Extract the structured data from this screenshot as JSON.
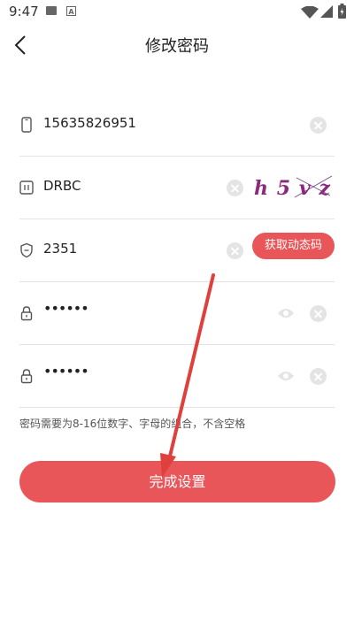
{
  "status_bar": {
    "time": "9:47",
    "icons": [
      "photo-icon",
      "a-notification-icon",
      "wifi-icon",
      "signal-icon",
      "battery-charging-icon"
    ]
  },
  "header": {
    "title": "修改密码",
    "back_icon": "chevron-left-icon"
  },
  "form": {
    "phone": {
      "value": "15635826951",
      "icon": "phone-icon"
    },
    "captcha": {
      "value": "DRBC",
      "icon": "captcha-icon",
      "image_text": "h5vz"
    },
    "sms_code": {
      "value": "2351",
      "icon": "shield-icon",
      "button_label": "获取动态码"
    },
    "password": {
      "value": "••••••",
      "icon": "lock-icon"
    },
    "confirm_password": {
      "value": "••••••",
      "icon": "lock-icon"
    }
  },
  "hint": "密码需要为8-16位数字、字母的组合，不含空格",
  "submit_label": "完成设置",
  "colors": {
    "accent": "#e8565a",
    "divider": "#e3e3e3",
    "clear_button": "#e4e4e4",
    "annotation_arrow": "#e0403c"
  }
}
